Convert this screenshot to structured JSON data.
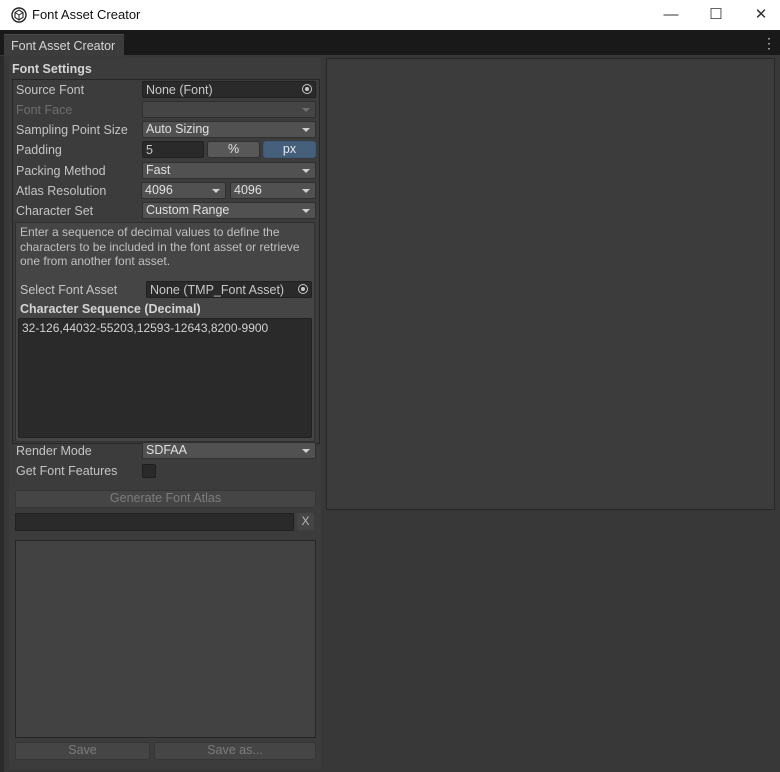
{
  "window": {
    "title": "Font Asset Creator",
    "minimize_glyph": "—",
    "maximize_glyph": "☐",
    "close_glyph": "✕"
  },
  "tab": {
    "label": "Font Asset Creator",
    "menu_glyph": "⋮"
  },
  "settings": {
    "section_title": "Font Settings",
    "source_font": {
      "label": "Source Font",
      "value": "None (Font)"
    },
    "font_face": {
      "label": "Font Face",
      "value": ""
    },
    "sampling_point_size": {
      "label": "Sampling Point Size",
      "value": "Auto Sizing"
    },
    "padding": {
      "label": "Padding",
      "value": "5",
      "percent_label": "%",
      "px_label": "px",
      "active_unit": "px"
    },
    "packing_method": {
      "label": "Packing Method",
      "value": "Fast"
    },
    "atlas_resolution": {
      "label": "Atlas Resolution",
      "width": "4096",
      "height": "4096"
    },
    "character_set": {
      "label": "Character Set",
      "value": "Custom Range"
    },
    "help_text": "Enter a sequence of decimal values to define the characters to be included in the font asset or retrieve one from another font asset.",
    "select_font_asset": {
      "label": "Select Font Asset",
      "value": "None (TMP_Font Asset)"
    },
    "character_sequence": {
      "label": "Character Sequence (Decimal)",
      "value": "32-126,44032-55203,12593-12643,8200-9900"
    },
    "render_mode": {
      "label": "Render Mode",
      "value": "SDFAA"
    },
    "get_font_features": {
      "label": "Get Font Features",
      "checked": false
    }
  },
  "actions": {
    "generate_label": "Generate Font Atlas",
    "progress": 0,
    "clear_label": "X",
    "save_label": "Save",
    "save_as_label": "Save as..."
  },
  "colors": {
    "accent": "#46607c",
    "panel": "#3c3c3c",
    "field": "#2a2a2a"
  }
}
